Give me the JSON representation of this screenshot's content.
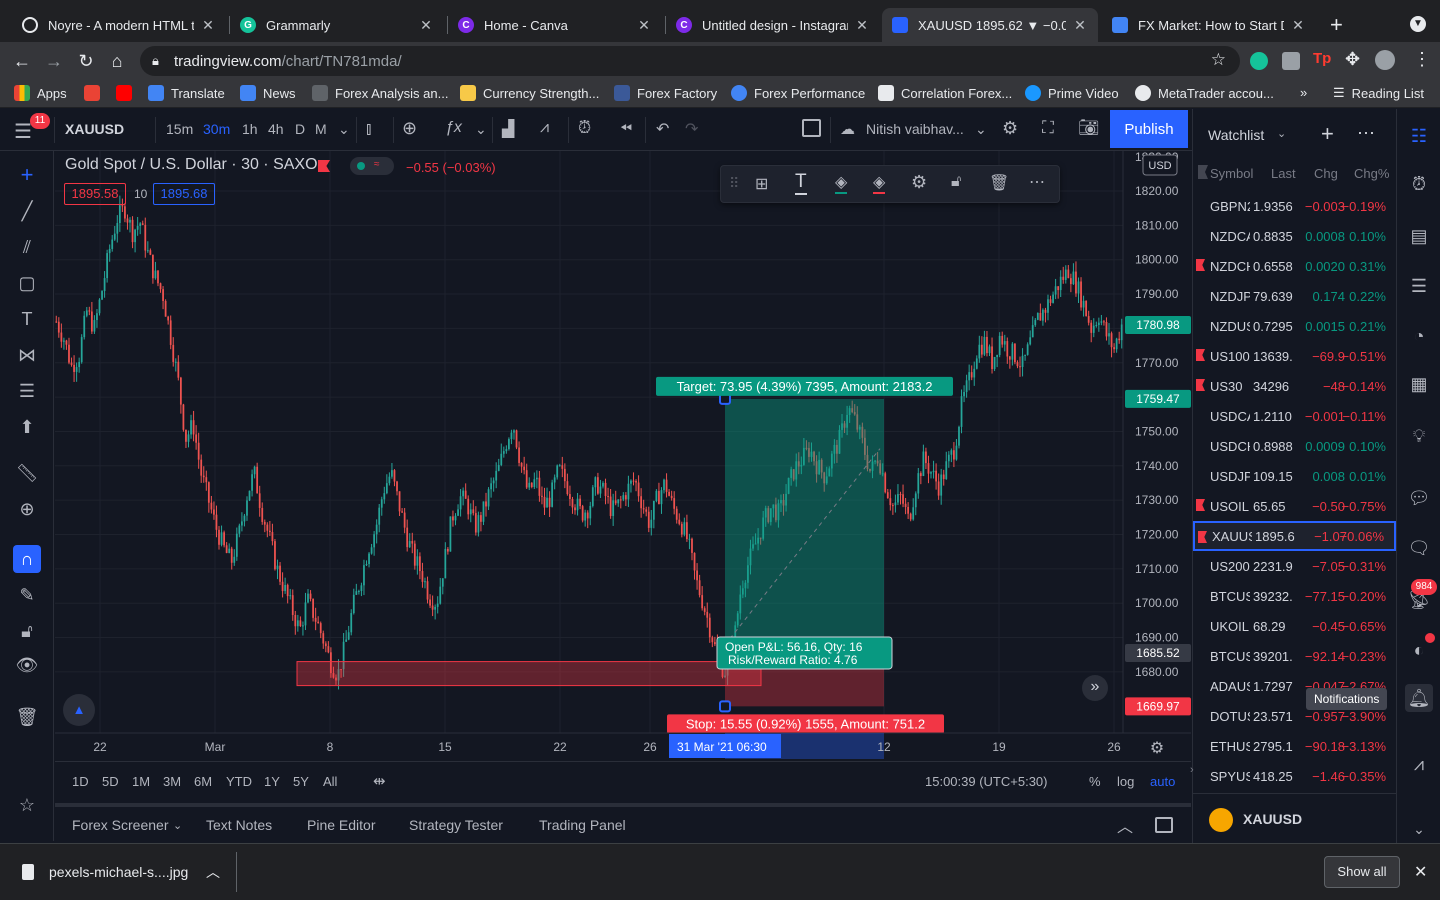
{
  "tabs": [
    {
      "label": "Noyre - A modern HTML te",
      "color": "#e8eaed"
    },
    {
      "label": "Grammarly",
      "color": "#15c39a"
    },
    {
      "label": "Home - Canva",
      "color": "#7d2ae8"
    },
    {
      "label": "Untitled design - Instagram",
      "color": "#7d2ae8"
    },
    {
      "label": "XAUUSD 1895.62 ▼ −0.06%",
      "color": "#2962ff"
    },
    {
      "label": "FX Market: How to Start Da",
      "color": "#4285f4"
    }
  ],
  "address": {
    "host": "tradingview.com",
    "path": "/chart/TN781mda/"
  },
  "bookmarks": [
    {
      "label": "Apps",
      "color": "#ea4335"
    },
    {
      "label": "",
      "color": "#ea4335"
    },
    {
      "label": "",
      "color": "#ff0000"
    },
    {
      "label": "Translate",
      "color": "#4285f4"
    },
    {
      "label": "News",
      "color": "#4285f4"
    },
    {
      "label": "Forex Analysis an...",
      "color": "#e8eaed"
    },
    {
      "label": "Currency Strength...",
      "color": "#f7c948"
    },
    {
      "label": "Forex Factory",
      "color": "#3b5998"
    },
    {
      "label": "Forex Performance",
      "color": "#4285f4"
    },
    {
      "label": "Correlation Forex...",
      "color": "#e8eaed"
    },
    {
      "label": "Prime Video",
      "color": "#1a98ff"
    },
    {
      "label": "MetaTrader accou...",
      "color": "#e8eaed"
    }
  ],
  "reading_list": "Reading List",
  "tv_toolbar": {
    "symbol": "XAUUSD",
    "intervals": [
      "15m",
      "30m",
      "1h",
      "4h",
      "D",
      "M"
    ],
    "selected_interval": "30m",
    "layout_name": "Nitish vaibhav...",
    "publish": "Publish",
    "badge": "11"
  },
  "legend": {
    "title": "Gold Spot / U.S. Dollar · 30 · SAXO",
    "change": "−0.55 (−0.03%)",
    "bid": "1895.58",
    "spread": "10",
    "ask": "1895.68"
  },
  "price_scale": {
    "currency": "USD",
    "ticks": [
      "1820.00",
      "1810.00",
      "1800.00",
      "1790.00",
      "1780.00",
      "1770.00",
      "1760.00",
      "1750.00",
      "1740.00",
      "1730.00",
      "1720.00",
      "1710.00",
      "1700.00",
      "1690.00",
      "1680.00"
    ],
    "top_tick": "1830.00",
    "labels": [
      {
        "text": "1780.98",
        "value": 1780.98,
        "color": "#089981"
      },
      {
        "text": "1759.47",
        "value": 1759.47,
        "color": "#089981"
      },
      {
        "text": "1685.52",
        "value": 1685.52,
        "color": "#363a45"
      },
      {
        "text": "1669.97",
        "value": 1669.97,
        "color": "#f23645"
      }
    ]
  },
  "time_axis": [
    "22",
    "Mar",
    "8",
    "15",
    "22",
    "26",
    "12",
    "19",
    "26"
  ],
  "time_highlight": {
    "date": "31 Mar '21",
    "time": "06:30"
  },
  "position": {
    "target": "Target: 73.95 (4.39%) 7395, Amount: 2183.2",
    "stop": "Stop: 15.55 (0.92%) 1555, Amount: 751.2",
    "pnl": "Open P&L: 56.16, Qty: 16",
    "rr": "Risk/Reward Ratio: 4.76",
    "entry": 1685.52,
    "target_price": 1759.47,
    "stop_price": 1669.97
  },
  "ranges": [
    "1D",
    "5D",
    "1M",
    "3M",
    "6M",
    "YTD",
    "1Y",
    "5Y",
    "All"
  ],
  "clock": "15:00:39 (UTC+5:30)",
  "scale_opts": [
    "%",
    "log",
    "auto"
  ],
  "panels": [
    "Forex Screener",
    "Text Notes",
    "Pine Editor",
    "Strategy Tester",
    "Trading Panel"
  ],
  "watchlist": {
    "title": "Watchlist",
    "headers": [
      "Symbol",
      "Last",
      "Chg",
      "Chg%"
    ],
    "rows": [
      {
        "sym": "GBPN2",
        "last": "1.9356",
        "chg": "−0.003",
        "pct": "−0.19%",
        "dir": "neg",
        "flag": false
      },
      {
        "sym": "NZDCA",
        "last": "0.8835",
        "chg": "0.0008",
        "pct": "0.10%",
        "dir": "pos",
        "flag": false
      },
      {
        "sym": "NZDCH",
        "last": "0.6558",
        "chg": "0.0020",
        "pct": "0.31%",
        "dir": "pos",
        "flag": true
      },
      {
        "sym": "NZDJP",
        "last": "79.639",
        "chg": "0.174",
        "pct": "0.22%",
        "dir": "pos",
        "flag": false
      },
      {
        "sym": "NZDUS",
        "last": "0.7295",
        "chg": "0.0015",
        "pct": "0.21%",
        "dir": "pos",
        "flag": false
      },
      {
        "sym": "US100",
        "last": "13639.",
        "chg": "−69.9",
        "pct": "−0.51%",
        "dir": "neg",
        "flag": true
      },
      {
        "sym": "US30",
        "last": "34296",
        "chg": "−48",
        "pct": "−0.14%",
        "dir": "neg",
        "flag": true
      },
      {
        "sym": "USDCA",
        "last": "1.2110",
        "chg": "−0.001",
        "pct": "−0.11%",
        "dir": "neg",
        "flag": false
      },
      {
        "sym": "USDCH",
        "last": "0.8988",
        "chg": "0.0009",
        "pct": "0.10%",
        "dir": "pos",
        "flag": false
      },
      {
        "sym": "USDJP",
        "last": "109.15",
        "chg": "0.008",
        "pct": "0.01%",
        "dir": "pos",
        "flag": false
      },
      {
        "sym": "USOIL",
        "last": "65.65",
        "chg": "−0.50",
        "pct": "−0.75%",
        "dir": "neg",
        "flag": true
      },
      {
        "sym": "XAUUS",
        "last": "1895.6",
        "chg": "−1.07",
        "pct": "−0.06%",
        "dir": "neg",
        "flag": true,
        "selected": true
      },
      {
        "sym": "US200",
        "last": "2231.9",
        "chg": "−7.05",
        "pct": "−0.31%",
        "dir": "neg",
        "flag": false
      },
      {
        "sym": "BTCUS",
        "last": "39232.",
        "chg": "−77.15",
        "pct": "−0.20%",
        "dir": "neg",
        "flag": false
      },
      {
        "sym": "UKOIL",
        "last": "68.29",
        "chg": "−0.45",
        "pct": "−0.65%",
        "dir": "neg",
        "flag": false
      },
      {
        "sym": "BTCUS",
        "last": "39201.",
        "chg": "−92.14",
        "pct": "−0.23%",
        "dir": "neg",
        "flag": false
      },
      {
        "sym": "ADAUS",
        "last": "1.7297",
        "chg": "−0.047",
        "pct": "−2.67%",
        "dir": "neg",
        "flag": false
      },
      {
        "sym": "DOTUS",
        "last": "23.571",
        "chg": "−0.957",
        "pct": "−3.90%",
        "dir": "neg",
        "flag": false
      },
      {
        "sym": "ETHUS",
        "last": "2795.1",
        "chg": "−90.18",
        "pct": "−3.13%",
        "dir": "neg",
        "flag": false
      },
      {
        "sym": "SPYUS",
        "last": "418.25",
        "chg": "−1.46",
        "pct": "−0.35%",
        "dir": "neg",
        "flag": false
      }
    ],
    "footer_symbol": "XAUUSD"
  },
  "tooltip": "Notifications",
  "notif_badge": "984",
  "download": {
    "file": "pexels-michael-s....jpg",
    "show_all": "Show all"
  },
  "price_path": [
    1782,
    1777,
    1769,
    1772,
    1785,
    1780,
    1791,
    1803,
    1812,
    1815,
    1808,
    1811,
    1802,
    1795,
    1790,
    1778,
    1765,
    1748,
    1752,
    1738,
    1730,
    1722,
    1716,
    1712,
    1720,
    1731,
    1738,
    1727,
    1719,
    1710,
    1704,
    1698,
    1692,
    1701,
    1696,
    1690,
    1683,
    1679,
    1688,
    1699,
    1707,
    1716,
    1722,
    1733,
    1738,
    1729,
    1720,
    1713,
    1709,
    1702,
    1700,
    1712,
    1725,
    1731,
    1729,
    1722,
    1726,
    1733,
    1738,
    1746,
    1753,
    1741,
    1732,
    1736,
    1728,
    1731,
    1739,
    1735,
    1730,
    1726,
    1728,
    1735,
    1732,
    1727,
    1729,
    1733,
    1736,
    1729,
    1723,
    1731,
    1735,
    1728,
    1724,
    1718,
    1707,
    1700,
    1692,
    1683,
    1680,
    1688,
    1705,
    1712,
    1718,
    1724,
    1728,
    1726,
    1733,
    1739,
    1742,
    1745,
    1740,
    1737,
    1743,
    1748,
    1757,
    1753,
    1746,
    1738,
    1743,
    1734,
    1728,
    1731,
    1724,
    1735,
    1742,
    1738,
    1734,
    1740,
    1745,
    1758,
    1765,
    1774,
    1776,
    1770,
    1778,
    1774,
    1772,
    1769,
    1776,
    1783,
    1786,
    1790,
    1794,
    1797,
    1793,
    1787,
    1780,
    1784,
    1778,
    1774,
    1781
  ]
}
